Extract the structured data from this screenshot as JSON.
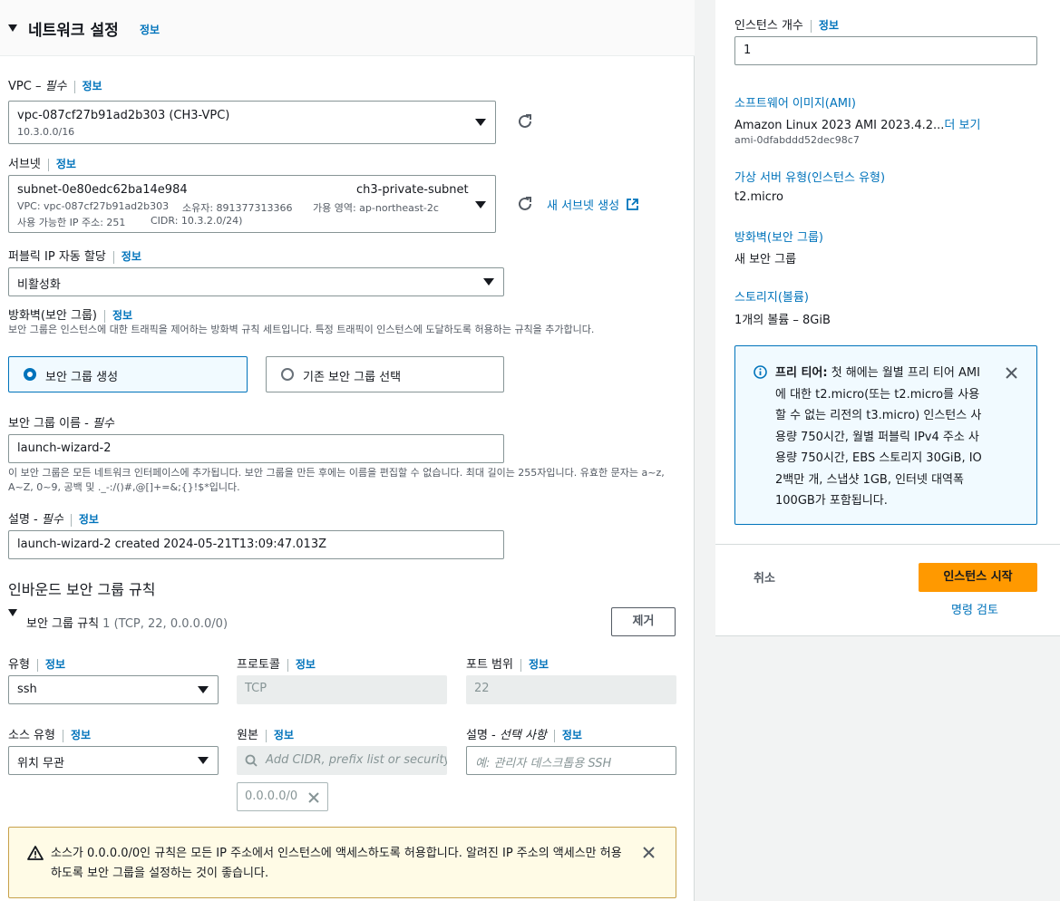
{
  "network": {
    "title": "네트워크 설정",
    "info": "정보"
  },
  "vpc": {
    "label": "VPC – ",
    "required": "필수",
    "info": "정보",
    "value": "vpc-087cf27b91ad2b303 (CH3-VPC)",
    "cidr": "10.3.0.0/16"
  },
  "subnet": {
    "label": "서브넷",
    "info": "정보",
    "id": "subnet-0e80edc62ba14e984",
    "name": "ch3-private-subnet",
    "vpc_line": "VPC: vpc-087cf27b91ad2b303",
    "owner_line": "소유자: 891377313366",
    "az_line": "가용 영역: ap-northeast-2c",
    "ip_line": "사용 가능한 IP 주소: 251",
    "cidr_line": "CIDR: 10.3.2.0/24)",
    "create_link": "새 서브넷 생성"
  },
  "public_ip": {
    "label": "퍼블릭 IP 자동 할당",
    "info": "정보",
    "value": "비활성화"
  },
  "firewall": {
    "label": "방화벽(보안 그룹)",
    "info": "정보",
    "desc": "보안 그룹은 인스턴스에 대한 트래픽을 제어하는 방화벽 규칙 세트입니다. 특정 트래픽이 인스턴스에 도달하도록 허용하는 규칙을 추가합니다.",
    "option_create": "보안 그룹 생성",
    "option_existing": "기존 보안 그룹 선택"
  },
  "sg_name": {
    "label": "보안 그룹 이름 - ",
    "required": "필수",
    "value": "launch-wizard-2",
    "desc": "이 보안 그룹은 모든 네트워크 인터페이스에 추가됩니다. 보안 그룹을 만든 후에는 이름을 편집할 수 없습니다. 최대 길이는 255자입니다. 유효한 문자는 a~z, A~Z, 0~9, 공백 및 ._-:/()#,@[]+=&;{}!$*입니다."
  },
  "description": {
    "label": "설명 - ",
    "required": "필수",
    "info": "정보",
    "value": "launch-wizard-2 created 2024-05-21T13:09:47.013Z"
  },
  "inbound": {
    "title": "인바운드 보안 그룹 규칙",
    "rule_title": "보안 그룹 규칙",
    "rule_summary": "1 (TCP, 22, 0.0.0.0/0)",
    "remove": "제거",
    "type_label": "유형",
    "type_info": "정보",
    "type_value": "ssh",
    "protocol_label": "프로토콜",
    "protocol_info": "정보",
    "protocol_value": "TCP",
    "port_label": "포트 범위",
    "port_info": "정보",
    "port_value": "22",
    "source_type_label": "소스 유형",
    "source_type_info": "정보",
    "source_type_value": "위치 무관",
    "source_label": "원본",
    "source_info": "정보",
    "source_placeholder": "Add CIDR, prefix list or security",
    "source_token": "0.0.0.0/0",
    "desc_label": "설명 - ",
    "desc_optional": "선택 사항",
    "desc_info": "정보",
    "desc_placeholder": "예: 관리자 데스크톱용 SSH"
  },
  "warning": {
    "text": "소스가 0.0.0.0/0인 규칙은 모든 IP 주소에서 인스턴스에 액세스하도록 허용합니다. 알려진 IP 주소의 액세스만 허용하도록 보안 그룹을 설정하는 것이 좋습니다."
  },
  "summary": {
    "instance_count_label": "인스턴스 개수",
    "instance_count_info": "정보",
    "instance_count": "1",
    "ami_link": "소프트웨어 이미지(AMI)",
    "ami_value": "Amazon Linux 2023 AMI 2023.4.2...",
    "ami_more": "더 보기",
    "ami_id": "ami-0dfabddd52dec98c7",
    "type_link": "가상 서버 유형(인스턴스 유형)",
    "type_value": "t2.micro",
    "firewall_link": "방화벽(보안 그룹)",
    "firewall_value": "새 보안 그룹",
    "storage_link": "스토리지(볼륨)",
    "storage_value": "1개의 볼륨 – 8GiB",
    "free_tier_title": "프리 티어:",
    "free_tier_text": " 첫 해에는 월별 프리 티어 AMI에 대한 t2.micro(또는 t2.micro를 사용할 수 없는 리전의 t3.micro) 인스턴스 사용량 750시간, 월별 퍼블릭 IPv4 주소 사용량 750시간, EBS 스토리지 30GiB, IO 2백만 개, 스냅샷 1GB, 인터넷 대역폭 100GB가 포함됩니다.",
    "cancel": "취소",
    "launch": "인스턴스 시작",
    "review": "명령 검토"
  },
  "colors": {
    "accent": "#0073bb",
    "launch_button": "#ff9900",
    "warning_bg": "#fffbe6",
    "warning_border": "#c7a14a"
  }
}
